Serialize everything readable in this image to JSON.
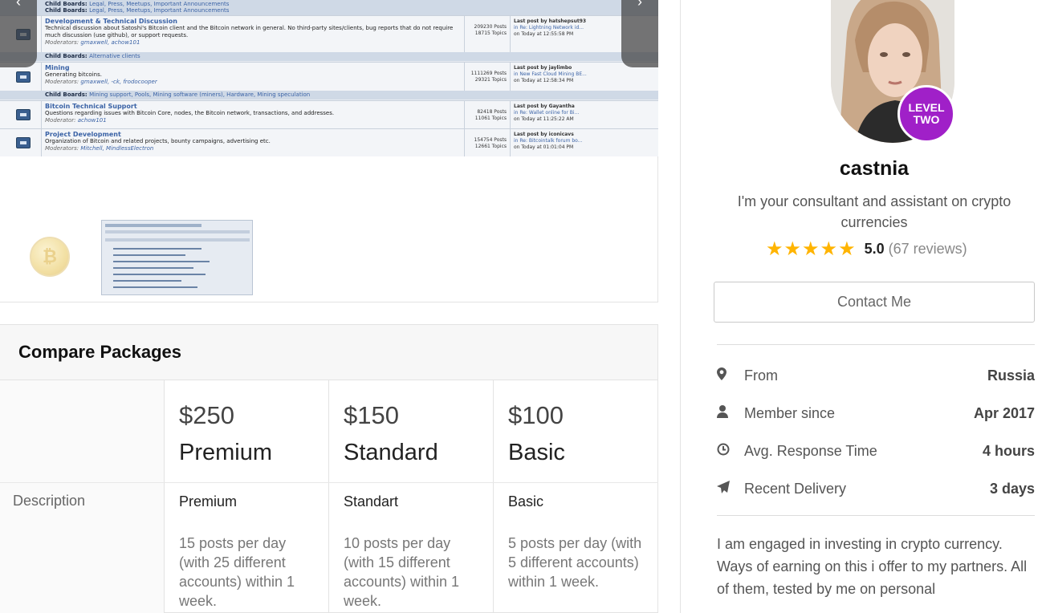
{
  "forum": {
    "top_child": {
      "label": "Child Boards:",
      "links": "Legal, Press, Meetups, Important Announcements"
    },
    "rows": [
      {
        "title": "Development & Technical Discussion",
        "desc": "Technical discussion about Satoshi's Bitcoin client and the Bitcoin network in general. No third-party sites/clients, bug reports that do not require much discussion (use github), or support requests.",
        "mods_label": "Moderators:",
        "mods": "gmaxwell, achow101",
        "posts": "209230 Posts",
        "topics": "18715 Topics",
        "last_by": "Last post by hatshepsut93",
        "last_in": "in Re: Lightning Network id...",
        "last_on": "on Today at 12:55:58 PM"
      },
      {
        "title": "Mining",
        "desc": "Generating bitcoins.",
        "mods_label": "Moderators:",
        "mods": "gmaxwell, -ck, frodocooper",
        "posts": "1111269 Posts",
        "topics": "29321 Topics",
        "last_by": "Last post by jaylimbo",
        "last_in": "in New Fast Cloud Mining BE...",
        "last_on": "on Today at 12:58:34 PM"
      },
      {
        "title": "Bitcoin Technical Support",
        "desc": "Questions regarding issues with Bitcoin Core, nodes, the Bitcoin network, transactions, and addresses.",
        "mods_label": "Moderator:",
        "mods": "achow101",
        "posts": "82418 Posts",
        "topics": "11061 Topics",
        "last_by": "Last post by Gayantha",
        "last_in": "in Re: Wallet online for Bi...",
        "last_on": "on Today at 11:25:22 AM"
      },
      {
        "title": "Project Development",
        "desc": "Organization of Bitcoin and related projects, bounty campaigns, advertising etc.",
        "mods_label": "Moderators:",
        "mods": "Mitchell, MindlessElectron",
        "posts": "154754 Posts",
        "topics": "12661 Topics",
        "last_by": "Last post by iconicavs",
        "last_in": "in Re: Bitcointalk forum bo...",
        "last_on": "on Today at 01:01:04 PM"
      }
    ],
    "child_1": {
      "label": "Child Boards:",
      "links": "Alternative clients"
    },
    "child_2": {
      "label": "Child Boards:",
      "links": "Mining support, Pools, Mining software (miners), Hardware, Mining speculation"
    }
  },
  "gallery": {
    "prev_icon": "chevron-left-icon",
    "next_icon": "chevron-right-icon"
  },
  "compare": {
    "title": "Compare Packages",
    "description_label": "Description",
    "packages": [
      {
        "price": "$250",
        "name": "Premium",
        "desc_title": "Premium",
        "desc_body": "15 posts per day (with 25 different accounts) within 1 week."
      },
      {
        "price": "$150",
        "name": "Standard",
        "desc_title": "Standart",
        "desc_body": "10 posts per day (with 15 different accounts) within 1 week."
      },
      {
        "price": "$100",
        "name": "Basic",
        "desc_title": "Basic",
        "desc_body": "5 posts per day (with 5 different accounts) within 1 week."
      }
    ]
  },
  "seller": {
    "level_line1": "LEVEL",
    "level_line2": "TWO",
    "username": "castnia",
    "tagline": "I'm your consultant and assistant on crypto currencies",
    "stars": "★★★★★",
    "rating": 5.0,
    "rating_text": "5.0",
    "reviews": "(67 reviews)",
    "contact_label": "Contact Me",
    "stats": [
      {
        "icon": "map-pin-icon",
        "label": "From",
        "value": "Russia"
      },
      {
        "icon": "user-icon",
        "label": "Member since",
        "value": "Apr 2017"
      },
      {
        "icon": "clock-icon",
        "label": "Avg. Response Time",
        "value": "4 hours"
      },
      {
        "icon": "paper-plane-icon",
        "label": "Recent Delivery",
        "value": "3 days"
      }
    ],
    "about": "I am engaged in investing in crypto currency. Ways of earning on this i offer to my partners. All of them, tested by me on personal"
  },
  "colors": {
    "accent_purple": "#a020c8",
    "star": "#ffb400",
    "forum_link": "#3b63a6"
  }
}
